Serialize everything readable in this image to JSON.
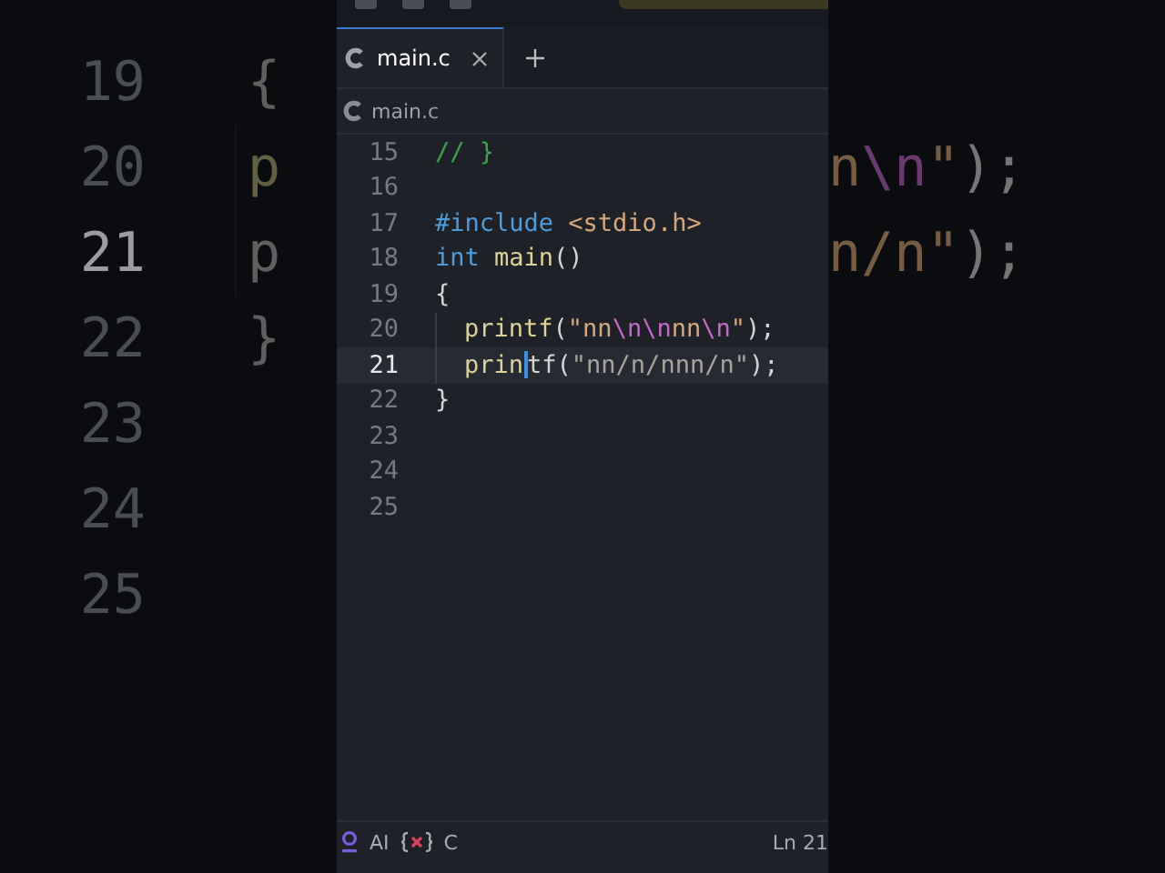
{
  "backdrop": {
    "left_lines": [
      {
        "number": "19",
        "current": false,
        "tokens": [
          {
            "kind": "punct",
            "text": "{"
          }
        ]
      },
      {
        "number": "20",
        "current": false,
        "tokens": [
          {
            "kind": "function",
            "text": "p"
          }
        ]
      },
      {
        "number": "21",
        "current": true,
        "tokens": [
          {
            "kind": "plain",
            "text": "p"
          }
        ]
      },
      {
        "number": "22",
        "current": false,
        "tokens": [
          {
            "kind": "punct",
            "text": "}"
          }
        ]
      },
      {
        "number": "23",
        "current": false
      },
      {
        "number": "24",
        "current": false
      },
      {
        "number": "25",
        "current": false
      }
    ],
    "right_lines": [
      {
        "tokens": [
          {
            "kind": "string",
            "text": "n"
          },
          {
            "kind": "escape",
            "text": "\\n"
          },
          {
            "kind": "string",
            "text": "\""
          },
          {
            "kind": "punct",
            "text": ");"
          }
        ]
      },
      {
        "tokens": [
          {
            "kind": "string",
            "text": "n/n\""
          },
          {
            "kind": "punct",
            "text": ");"
          }
        ]
      }
    ]
  },
  "tabs": [
    {
      "label": "main.c",
      "selected": true
    }
  ],
  "breadcrumb": "main.c",
  "lines": [
    {
      "number": "15",
      "current": false,
      "tokens": [
        {
          "kind": "comment",
          "text": "// }"
        }
      ]
    },
    {
      "number": "16",
      "current": false
    },
    {
      "number": "17",
      "current": false,
      "tokens": [
        {
          "kind": "keyword",
          "text": "#include"
        },
        {
          "kind": "space"
        },
        {
          "kind": "string",
          "text": "<stdio.h>"
        }
      ]
    },
    {
      "number": "18",
      "current": false,
      "tokens": [
        {
          "kind": "keyword",
          "text": "int"
        },
        {
          "kind": "space"
        },
        {
          "kind": "function",
          "text": "main"
        },
        {
          "kind": "punct",
          "text": "()"
        }
      ]
    },
    {
      "number": "19",
      "current": false,
      "tokens": [
        {
          "kind": "punct",
          "text": "{"
        }
      ]
    },
    {
      "number": "20",
      "current": false,
      "tokens": [
        {
          "kind": "indent"
        },
        {
          "kind": "function",
          "text": "printf"
        },
        {
          "kind": "punct",
          "text": "("
        },
        {
          "kind": "string",
          "text": "\"nn"
        },
        {
          "kind": "escape",
          "text": "\\n\\n"
        },
        {
          "kind": "string",
          "text": "nn"
        },
        {
          "kind": "escape",
          "text": "\\n"
        },
        {
          "kind": "string",
          "text": "\""
        },
        {
          "kind": "punct",
          "text": ");"
        }
      ]
    },
    {
      "number": "21",
      "current": true,
      "tokens": [
        {
          "kind": "indent"
        },
        {
          "kind": "function",
          "text": "prin"
        },
        {
          "kind": "caret"
        },
        {
          "kind": "plain",
          "text": "tf"
        },
        {
          "kind": "punct",
          "text": "("
        },
        {
          "kind": "dimstring",
          "text": "\"nn/n/nnn/n\""
        },
        {
          "kind": "punct",
          "text": ");"
        }
      ]
    },
    {
      "number": "22",
      "current": false,
      "tokens": [
        {
          "kind": "punct",
          "text": "}"
        }
      ]
    },
    {
      "number": "23",
      "current": false
    },
    {
      "number": "24",
      "current": false
    },
    {
      "number": "25",
      "current": false
    }
  ],
  "status_bar": {
    "ai_label": "AI",
    "language": "C",
    "position": "Ln 21"
  }
}
